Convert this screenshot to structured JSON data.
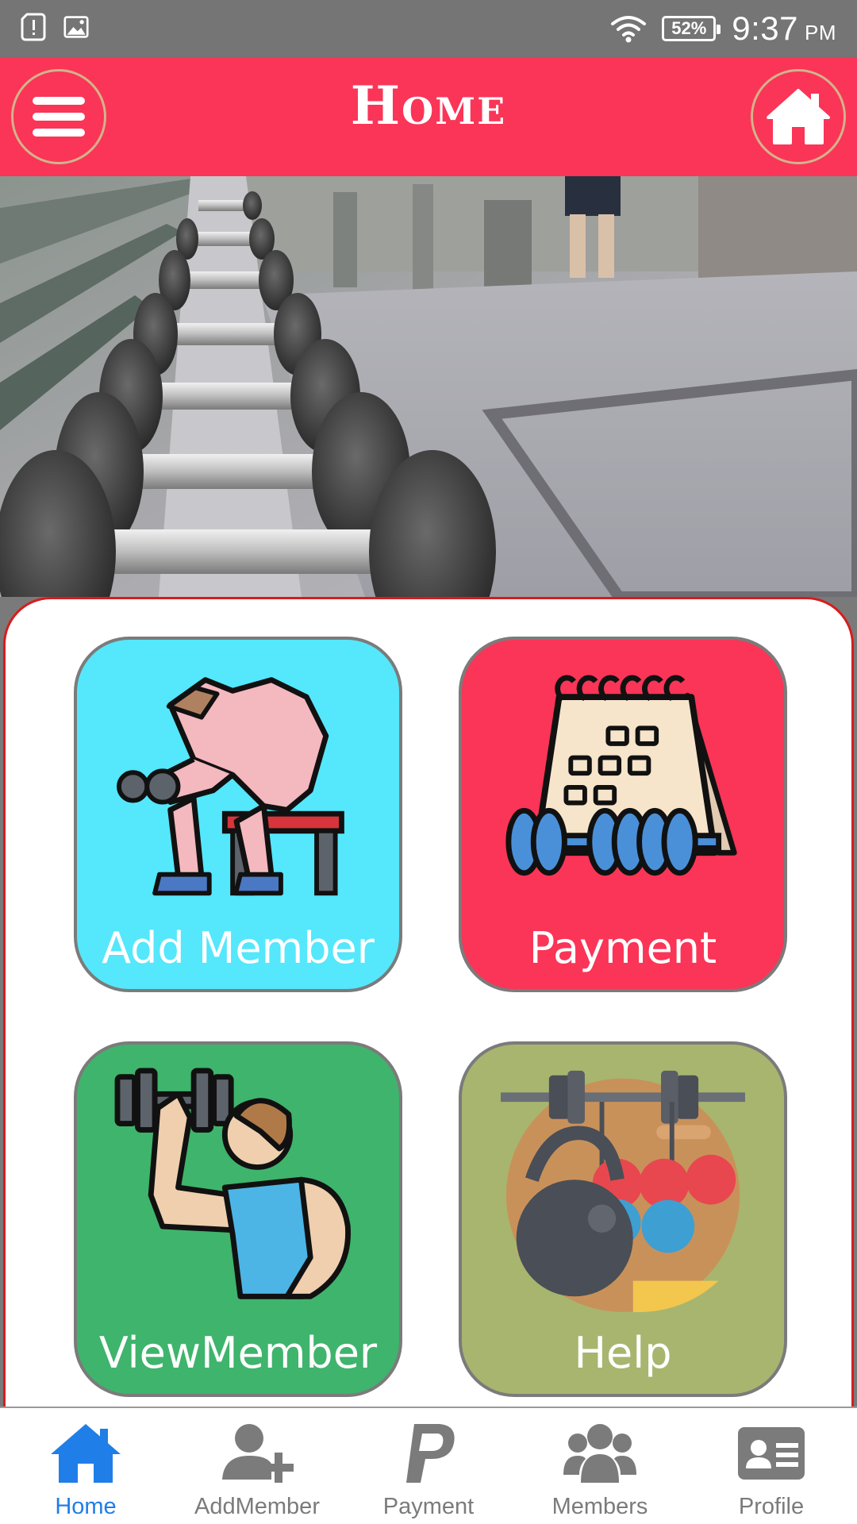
{
  "status_bar": {
    "battery": "52%",
    "time": "9:37",
    "ampm": "PM"
  },
  "header": {
    "title": "Home"
  },
  "tiles": [
    {
      "label": "Add Member"
    },
    {
      "label": "Payment"
    },
    {
      "label": "ViewMember"
    },
    {
      "label": "Help"
    }
  ],
  "bottom_nav": {
    "active": "Home",
    "accent_color": "#1f7ee8",
    "inactive_color": "#7b7b7b",
    "items": [
      {
        "label": "Home",
        "icon": "home-icon"
      },
      {
        "label": "AddMember",
        "icon": "add-user-icon"
      },
      {
        "label": "Payment",
        "icon": "paypal-icon"
      },
      {
        "label": "Members",
        "icon": "users-icon"
      },
      {
        "label": "Profile",
        "icon": "id-card-icon"
      }
    ]
  },
  "colors": {
    "header": "#fa3557",
    "status_bar": "#757575",
    "add_member_tile": "#55e7fb",
    "payment_tile": "#fa3557",
    "view_member_tile": "#3fb46c",
    "help_tile": "#a8b56e"
  }
}
